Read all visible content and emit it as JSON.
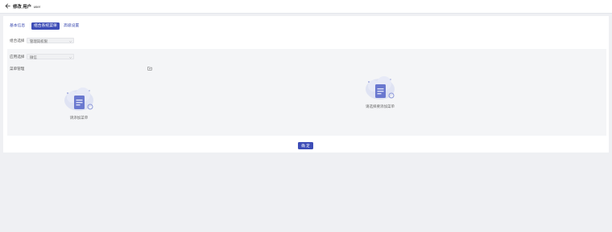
{
  "header": {
    "title_prefix": "修改 用户",
    "username": "user"
  },
  "tabs": [
    {
      "label": "基本信息",
      "active": false
    },
    {
      "label": "组合系统菜单",
      "active": true
    },
    {
      "label": "高级设置",
      "active": false
    }
  ],
  "form": {
    "combo_label": "组合选择",
    "combo_value": "管理岗权限",
    "app_label": "应用选择",
    "app_value": "微信"
  },
  "menu_manage": {
    "label": "菜单管理",
    "left_empty_text": "请添加菜单",
    "right_empty_text": "请选择要添加菜单"
  },
  "footer": {
    "confirm_label": "确 定"
  },
  "colors": {
    "accent": "#3d4db7",
    "link": "#3b4bb0",
    "page_bg": "#eff0f3"
  }
}
